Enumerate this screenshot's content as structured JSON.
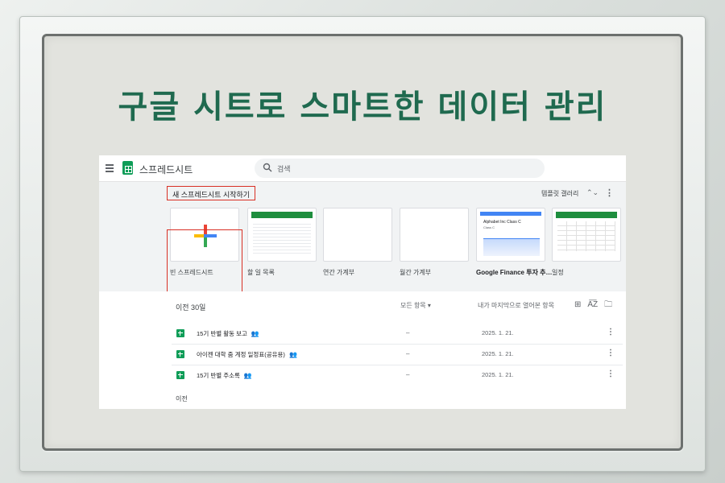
{
  "headline": "구글 시트로 스마트한 데이터 관리",
  "app": {
    "title": "스프레드시트",
    "search_placeholder": "검색"
  },
  "template_gallery": {
    "start_label": "새 스프레드시트 시작하기",
    "gallery_label": "템플릿 갤러리",
    "templates": [
      {
        "name": "빈 스프레드시트"
      },
      {
        "name": "할 일 목록"
      },
      {
        "name": "연간 가계부"
      },
      {
        "name": "월간 가계부"
      },
      {
        "name": "Google Finance 투자 추…",
        "preview_title": "Alphabet Inc Class C",
        "preview_sub": "Class C"
      },
      {
        "name": "일정"
      }
    ]
  },
  "recent": {
    "title": "이전 30일",
    "owner_filter": "모든 항목 ▾",
    "sort_label": "내가 마지막으로 열어본 항목",
    "view_icons": [
      "grid-view-icon",
      "sort-az-icon",
      "folder-icon"
    ],
    "files": [
      {
        "name": "15기 반별 활동 보고",
        "owner": "–",
        "date": "2025. 1. 21.",
        "shared": true
      },
      {
        "name": "아이젠 대학 줌 계정 일정표(공유용)",
        "owner": "–",
        "date": "2025. 1. 21.",
        "shared": true
      },
      {
        "name": "15기 반별 주소록",
        "owner": "–",
        "date": "2025. 1. 21.",
        "shared": true
      }
    ],
    "earlier_label": "이전"
  },
  "colors": {
    "headline": "#1f6a4f",
    "highlight": "#d93025",
    "sheets_green": "#0f9d58"
  }
}
